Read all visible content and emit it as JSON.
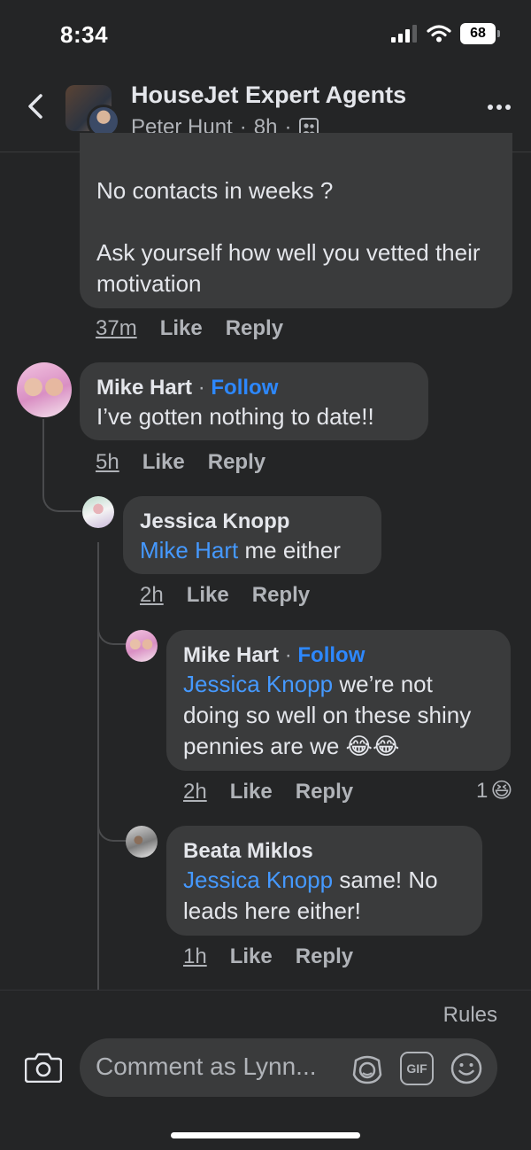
{
  "status_bar": {
    "time": "8:34",
    "battery": "68"
  },
  "header": {
    "title": "HouseJet Expert Agents",
    "author": "Peter Hunt",
    "sep1": "·",
    "time": "8h",
    "sep2": "·"
  },
  "comments": [
    {
      "text_line1": "No contacts in weeks ?",
      "text_line2": "Ask yourself how well you vetted their motivation",
      "time": "37m",
      "like": "Like",
      "reply": "Reply"
    },
    {
      "author": "Mike Hart",
      "sep": "·",
      "follow": "Follow",
      "text": "I’ve gotten nothing to date!!",
      "time": "5h",
      "like": "Like",
      "reply": "Reply"
    },
    {
      "author": "Jessica Knopp",
      "mention": "Mike Hart",
      "text": " me either",
      "time": "2h",
      "like": "Like",
      "reply": "Reply"
    },
    {
      "author": "Mike Hart",
      "sep": "·",
      "follow": "Follow",
      "mention": "Jessica Knopp",
      "text": " we’re not doing so well on these shiny pennies are we 😂😂",
      "time": "2h",
      "like": "Like",
      "reply": "Reply",
      "reaction_count": "1",
      "reaction_emoji": "😆"
    },
    {
      "author": "Beata Miklos",
      "mention": "Jessica Knopp",
      "text": " same! No leads here either!",
      "time": "1h",
      "like": "Like",
      "reply": "Reply"
    }
  ],
  "composer": {
    "rules": "Rules",
    "placeholder": "Comment as Lynn...",
    "gif": "GIF"
  },
  "colors": {
    "background": "#242526",
    "bubble": "#3a3b3c",
    "follow": "#2d88ff",
    "mention": "#4599ff",
    "secondary_text": "#b0b3b8"
  },
  "icons": [
    "back-arrow-icon",
    "more-icon",
    "group-members-icon",
    "camera-icon",
    "avatar-sticker-icon",
    "gif-icon",
    "emoji-icon",
    "signal-icon",
    "wifi-icon",
    "battery-icon"
  ]
}
